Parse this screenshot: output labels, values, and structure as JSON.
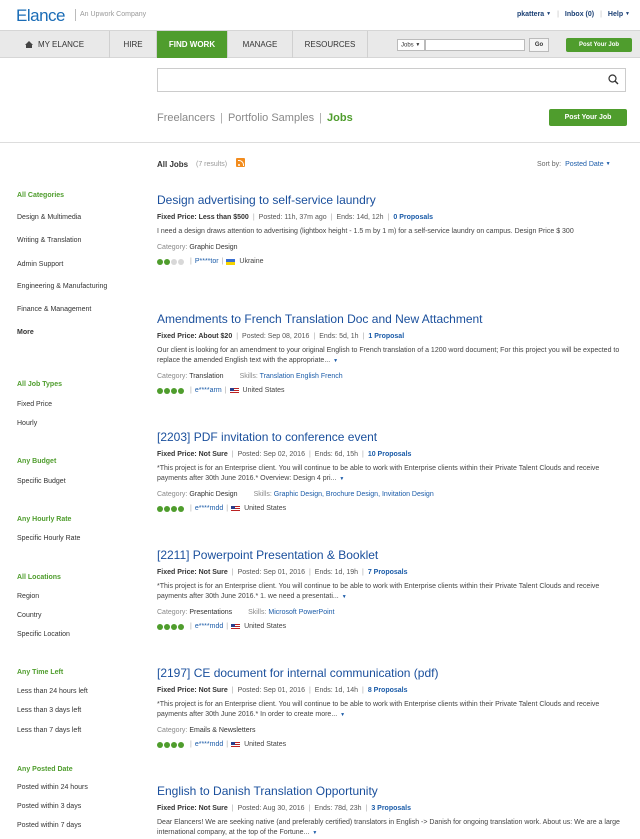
{
  "topbar": {
    "logo": "Elance",
    "logo_sub": "An Upwork Company",
    "username": "pkattera",
    "inbox": "Inbox (0)",
    "help": "Help"
  },
  "nav": {
    "items": [
      "MY ELANCE",
      "HIRE",
      "FIND WORK",
      "MANAGE",
      "RESOURCES"
    ],
    "active": "FIND WORK",
    "search_scope": "Jobs",
    "go": "Go",
    "post_job": "Post Your Job"
  },
  "search": {
    "tabs": [
      "Freelancers",
      "Portfolio Samples",
      "Jobs"
    ],
    "active_tab": "Jobs",
    "post_job": "Post Your Job"
  },
  "results": {
    "heading": "All Jobs",
    "count": "(7 results)",
    "sort_label": "Sort by:",
    "sort_value": "Posted Date"
  },
  "sidebar": {
    "categories_title": "All Categories",
    "categories": [
      "Design & Multimedia",
      "Writing & Translation",
      "Admin Support",
      "Engineering & Manufacturing",
      "Finance & Management"
    ],
    "more": "More",
    "job_types_title": "All Job Types",
    "job_types": [
      "Fixed Price",
      "Hourly"
    ],
    "budget_title": "Any Budget",
    "budget": [
      "Specific Budget"
    ],
    "hourly_title": "Any Hourly Rate",
    "hourly": [
      "Specific Hourly Rate"
    ],
    "locations_title": "All Locations",
    "locations": [
      "Region",
      "Country",
      "Specific Location"
    ],
    "time_left_title": "Any Time Left",
    "time_left": [
      "Less than 24 hours left",
      "Less than 3 days left",
      "Less than 7 days left"
    ],
    "posted_title": "Any Posted Date",
    "posted": [
      "Posted within 24 hours",
      "Posted within 3 days",
      "Posted within 7 days"
    ]
  },
  "jobs": [
    {
      "title": "Design advertising to self-service laundry",
      "price": "Fixed Price: Less than $500",
      "posted": "Posted: 11h, 37m ago",
      "ends": "Ends: 14d, 12h",
      "proposals": "0 Proposals",
      "desc": "I need a design draws attention to advertising (lightbox height - 1.5 m by 1 m) for a self-service laundry on campus. Design Price $ 300",
      "category_label": "Category:",
      "category": "Graphic Design",
      "skills_label": "",
      "skills": "",
      "client": "P****tor",
      "country": "Ukraine",
      "flag": "ua",
      "rating": 2,
      "has_more": false
    },
    {
      "title": "Amendments to French Translation Doc and New Attachment",
      "price": "Fixed Price: About $20",
      "posted": "Posted: Sep 08, 2016",
      "ends": "Ends: 5d, 1h",
      "proposals": "1 Proposal",
      "desc": "Our client is looking for an amendment to your original English to French translation of a 1200 word document; For this project you will be expected to replace the amended English text with the appropriate...",
      "category_label": "Category:",
      "category": "Translation",
      "skills_label": "Skills:",
      "skills": "Translation English French",
      "client": "e****arm",
      "country": "United States",
      "flag": "us",
      "rating": 4,
      "has_more": true
    },
    {
      "title": "[2203] PDF invitation to conference event",
      "price": "Fixed Price: Not Sure",
      "posted": "Posted: Sep 02, 2016",
      "ends": "Ends: 6d, 15h",
      "proposals": "10 Proposals",
      "desc": "*This project is for an Enterprise client. You will continue to be able to work with Enterprise clients within their Private Talent Clouds and receive payments after 30th June 2016.* Overview: Design 4 pri...",
      "category_label": "Category:",
      "category": "Graphic Design",
      "skills_label": "Skills:",
      "skills": "Graphic Design, Brochure Design, Invitation Design",
      "client": "e****mdd",
      "country": "United States",
      "flag": "us",
      "rating": 4,
      "has_more": true
    },
    {
      "title": "[2211] Powerpoint Presentation & Booklet",
      "price": "Fixed Price: Not Sure",
      "posted": "Posted: Sep 01, 2016",
      "ends": "Ends: 1d, 19h",
      "proposals": "7 Proposals",
      "desc": "*This project is for an Enterprise client. You will continue to be able to work with Enterprise clients within their Private Talent Clouds and receive payments after 30th June 2016.* 1. we need a presentati...",
      "category_label": "Category:",
      "category": "Presentations",
      "skills_label": "Skills:",
      "skills": "Microsoft PowerPoint",
      "client": "e****mdd",
      "country": "United States",
      "flag": "us",
      "rating": 4,
      "has_more": true
    },
    {
      "title": "[2197] CE document for internal communication (pdf)",
      "price": "Fixed Price: Not Sure",
      "posted": "Posted: Sep 01, 2016",
      "ends": "Ends: 1d, 14h",
      "proposals": "8 Proposals",
      "desc": "*This project is for an Enterprise client. You will continue to be able to work with Enterprise clients within their Private Talent Clouds and receive payments after 30th June 2016.* In order to create more...",
      "category_label": "Category:",
      "category": "Emails & Newsletters",
      "skills_label": "",
      "skills": "",
      "client": "e****mdd",
      "country": "United States",
      "flag": "us",
      "rating": 4,
      "has_more": true
    },
    {
      "title": "English to Danish Translation Opportunity",
      "price": "Fixed Price: Not Sure",
      "posted": "Posted: Aug 30, 2016",
      "ends": "Ends: 78d, 23h",
      "proposals": "3 Proposals",
      "desc": "Dear Elancers! We are seeking native (and preferably certified) translators in English -> Danish for ongoing translation work. About us: We are a large international company, at the top of the Fortune...",
      "category_label": "",
      "category": "",
      "skills_label": "",
      "skills": "",
      "client": "",
      "country": "",
      "flag": "",
      "rating": 0,
      "has_more": true
    }
  ]
}
